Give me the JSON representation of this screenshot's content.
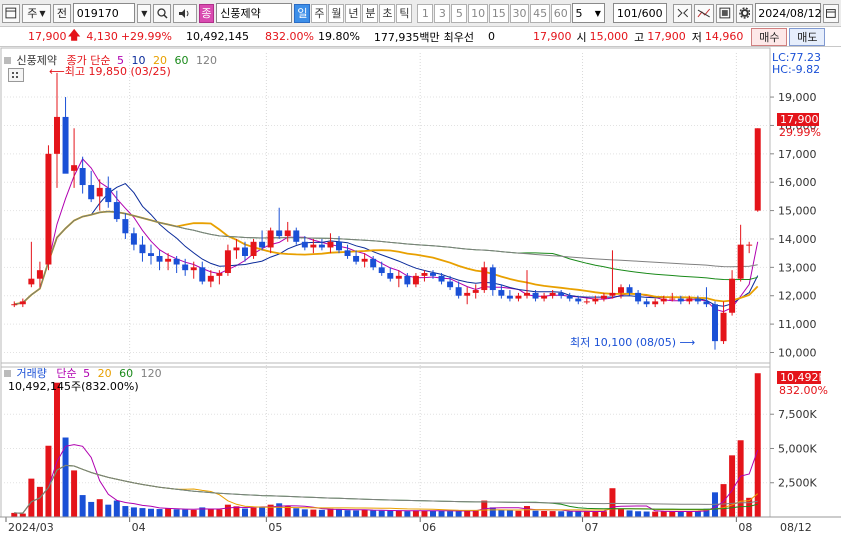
{
  "toolbar": {
    "market_type": "주",
    "prev_label": "전",
    "code": "019170",
    "name_badge": "종",
    "name": "신풍제약",
    "period_tabs": [
      "일",
      "주",
      "월",
      "년",
      "분",
      "초",
      "틱"
    ],
    "active_period": "일",
    "num_periods": [
      "1",
      "3",
      "5",
      "10",
      "15",
      "30",
      "45",
      "60"
    ],
    "period_count": "5",
    "page": "101",
    "page_total": "/600",
    "date": "2024/08/12"
  },
  "quote": {
    "price": "17,900",
    "change": "4,130",
    "change_rate": "+29.99%",
    "volume": "10,492,145",
    "volume_ratio": "832.00%",
    "turnover": "19.80%",
    "amount": "177,935백만",
    "bid_label": "최우선",
    "bid_qty": "0",
    "best_price": "17,900",
    "open_label": "시",
    "open": "15,000",
    "high_label": "고",
    "high": "17,900",
    "low_label": "저",
    "low": "14,960",
    "buy_button": "매수",
    "sell_button": "매도"
  },
  "price_panel": {
    "title": "신풍제약",
    "legend_label": "종가 단순",
    "ma_periods": [
      "5",
      "10",
      "20",
      "60",
      "120"
    ],
    "ma_colors": [
      "#b000b0",
      "#0a2a9a",
      "#e8a000",
      "#1a8a1a",
      "#808080"
    ],
    "lc": "LC:77.23",
    "hc": "HC:-9.82",
    "high_annotation": "최고 19,850 (03/25)",
    "low_annotation": "최저 10,100 (08/05)",
    "last_price_tag": "17,900",
    "last_rate_tag": "29.99%",
    "y_ticks": [
      "19,000",
      "18,000",
      "17,000",
      "16,000",
      "15,000",
      "14,000",
      "13,000",
      "12,000",
      "11,000",
      "10,000"
    ]
  },
  "volume_panel": {
    "title": "거래량",
    "legend_label": "단순",
    "ma_periods": [
      "5",
      "20",
      "60",
      "120"
    ],
    "value_text": "10,492,145주(832.00%)",
    "last_volume_tag": "10,492K",
    "last_ratio_tag": "832.00%",
    "y_ticks": [
      "7,500K",
      "5,000K",
      "2,500K"
    ]
  },
  "x_axis": {
    "labels": [
      "2024/03",
      "04",
      "05",
      "06",
      "07",
      "08"
    ],
    "right_label": "08/12"
  },
  "colors": {
    "up": "#e4141a",
    "down": "#1a50d6",
    "accent": "#3c8ee8"
  },
  "chart_data": {
    "type": "candlestick",
    "ohlc": [
      [
        11700,
        11800,
        11600,
        11700
      ],
      [
        11700,
        11900,
        11600,
        11800
      ],
      [
        12400,
        13900,
        12300,
        12600
      ],
      [
        12600,
        13200,
        12300,
        12900
      ],
      [
        13100,
        17300,
        12900,
        17000
      ],
      [
        17000,
        19850,
        15800,
        18300
      ],
      [
        18300,
        19000,
        17200,
        16300
      ],
      [
        16400,
        17900,
        15800,
        16600
      ],
      [
        16500,
        16900,
        15600,
        15900
      ],
      [
        15900,
        16400,
        15300,
        15400
      ],
      [
        15500,
        16100,
        15000,
        15800
      ],
      [
        15800,
        16200,
        15100,
        15300
      ],
      [
        15300,
        15700,
        14600,
        14700
      ],
      [
        14700,
        14900,
        14000,
        14200
      ],
      [
        14200,
        14400,
        13600,
        13800
      ],
      [
        13800,
        14100,
        13200,
        13500
      ],
      [
        13500,
        13800,
        13100,
        13400
      ],
      [
        13400,
        13600,
        12900,
        13200
      ],
      [
        13200,
        13500,
        12900,
        13300
      ],
      [
        13300,
        13400,
        12800,
        13100
      ],
      [
        13100,
        13300,
        12700,
        12900
      ],
      [
        12900,
        13200,
        12600,
        13000
      ],
      [
        13000,
        13200,
        12400,
        12500
      ],
      [
        12500,
        12900,
        12300,
        12700
      ],
      [
        12700,
        12900,
        12400,
        12800
      ],
      [
        12800,
        13800,
        12700,
        13600
      ],
      [
        13600,
        14000,
        13300,
        13700
      ],
      [
        13700,
        13900,
        13200,
        13400
      ],
      [
        13400,
        14000,
        13300,
        13900
      ],
      [
        13900,
        14300,
        13600,
        13700
      ],
      [
        13700,
        14400,
        13500,
        14300
      ],
      [
        14300,
        15100,
        14000,
        14100
      ],
      [
        14100,
        14600,
        13900,
        14300
      ],
      [
        14300,
        14400,
        13800,
        13900
      ],
      [
        13900,
        14100,
        13600,
        13700
      ],
      [
        13700,
        14000,
        13500,
        13800
      ],
      [
        13800,
        14000,
        13600,
        13700
      ],
      [
        13700,
        14200,
        13500,
        13900
      ],
      [
        13900,
        14100,
        13500,
        13600
      ],
      [
        13600,
        13800,
        13300,
        13400
      ],
      [
        13400,
        13600,
        13100,
        13200
      ],
      [
        13200,
        13500,
        13000,
        13300
      ],
      [
        13300,
        13400,
        12900,
        13000
      ],
      [
        13000,
        13200,
        12700,
        12800
      ],
      [
        12800,
        13000,
        12500,
        12600
      ],
      [
        12600,
        12900,
        12300,
        12700
      ],
      [
        12700,
        12800,
        12300,
        12400
      ],
      [
        12400,
        12800,
        12300,
        12700
      ],
      [
        12700,
        12900,
        12500,
        12800
      ],
      [
        12800,
        12900,
        12600,
        12700
      ],
      [
        12700,
        12800,
        12400,
        12500
      ],
      [
        12500,
        12700,
        12200,
        12300
      ],
      [
        12300,
        12500,
        11900,
        12000
      ],
      [
        12000,
        12300,
        11700,
        12100
      ],
      [
        12100,
        12400,
        11900,
        12200
      ],
      [
        12200,
        13200,
        12100,
        13000
      ],
      [
        13000,
        13100,
        12000,
        12200
      ],
      [
        12200,
        12400,
        11900,
        12000
      ],
      [
        12000,
        12200,
        11800,
        11900
      ],
      [
        11900,
        12100,
        11800,
        12000
      ],
      [
        12000,
        12900,
        11900,
        12100
      ],
      [
        12100,
        12200,
        11800,
        11900
      ],
      [
        11900,
        12100,
        11800,
        12000
      ],
      [
        12000,
        12200,
        11900,
        12100
      ],
      [
        12100,
        12200,
        11900,
        12000
      ],
      [
        12000,
        12100,
        11800,
        11900
      ],
      [
        11900,
        12000,
        11700,
        11800
      ],
      [
        11800,
        11900,
        11700,
        11800
      ],
      [
        11800,
        12000,
        11700,
        11900
      ],
      [
        11900,
        12100,
        11800,
        12000
      ],
      [
        12000,
        13600,
        11900,
        12100
      ],
      [
        12100,
        12400,
        11900,
        12300
      ],
      [
        12300,
        12400,
        12000,
        12100
      ],
      [
        12100,
        12200,
        11700,
        11800
      ],
      [
        11800,
        11900,
        11600,
        11700
      ],
      [
        11700,
        11900,
        11600,
        11800
      ],
      [
        11800,
        12000,
        11700,
        11900
      ],
      [
        11900,
        12100,
        11800,
        11900
      ],
      [
        11900,
        12000,
        11700,
        11800
      ],
      [
        11800,
        12000,
        11700,
        11900
      ],
      [
        11900,
        12000,
        11700,
        11800
      ],
      [
        11800,
        12300,
        11600,
        11700
      ],
      [
        11700,
        11800,
        10100,
        10400
      ],
      [
        10400,
        11800,
        10300,
        11400
      ],
      [
        11400,
        12900,
        11300,
        12600
      ],
      [
        12600,
        14500,
        12500,
        13800
      ],
      [
        13800,
        13900,
        13500,
        13800
      ],
      [
        15000,
        17900,
        14960,
        17900
      ]
    ],
    "volume": [
      300,
      250,
      2800,
      2200,
      5200,
      9800,
      5800,
      3400,
      1600,
      1100,
      1300,
      900,
      1200,
      800,
      700,
      650,
      600,
      580,
      620,
      560,
      540,
      520,
      700,
      600,
      550,
      900,
      780,
      620,
      680,
      700,
      900,
      1000,
      820,
      640,
      560,
      540,
      520,
      600,
      550,
      500,
      480,
      520,
      470,
      460,
      450,
      440,
      430,
      480,
      460,
      450,
      440,
      430,
      420,
      480,
      470,
      1200,
      700,
      520,
      480,
      450,
      800,
      460,
      440,
      430,
      420,
      410,
      400,
      390,
      380,
      420,
      2100,
      600,
      480,
      420,
      400,
      390,
      400,
      410,
      400,
      420,
      400,
      600,
      1800,
      2400,
      4500,
      5600,
      1400,
      10492
    ],
    "ylim_price": [
      9700,
      20200
    ],
    "ylim_volume": [
      0,
      10800
    ],
    "x_labels": [
      "2024/03",
      "04",
      "05",
      "06",
      "07",
      "08"
    ]
  }
}
